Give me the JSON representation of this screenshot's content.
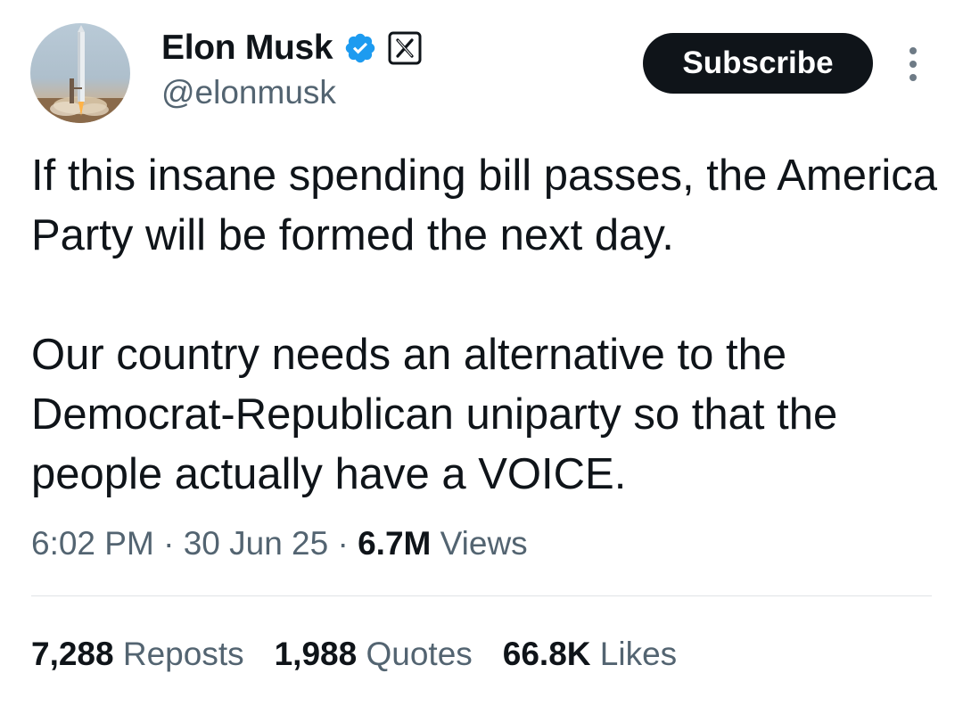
{
  "author": {
    "name": "Elon Musk",
    "handle": "@elonmusk",
    "avatar_icon": "rocket-launch-photo",
    "verified_icon": "verified-badge-icon",
    "affiliation_icon": "x-logo-icon"
  },
  "actions": {
    "subscribe_label": "Subscribe",
    "more_icon": "more-vertical-icon"
  },
  "tweet": {
    "paragraphs": [
      "If this insane spending bill passes, the America Party will be formed the next day.",
      "Our country needs an alternative to the Democrat-Republican uniparty so that the people actually have a VOICE."
    ]
  },
  "meta": {
    "time": "6:02 PM",
    "separator": "·",
    "date": "30 Jun 25",
    "views_count": "6.7M",
    "views_label": "Views"
  },
  "stats": [
    {
      "count": "7,288",
      "label": "Reposts"
    },
    {
      "count": "1,988",
      "label": "Quotes"
    },
    {
      "count": "66.8K",
      "label": "Likes"
    }
  ],
  "colors": {
    "text_primary": "#0f1419",
    "text_secondary": "#536471",
    "verified_blue": "#1d9bf0",
    "button_bg": "#0f1419",
    "divider": "#dfe3e6"
  }
}
